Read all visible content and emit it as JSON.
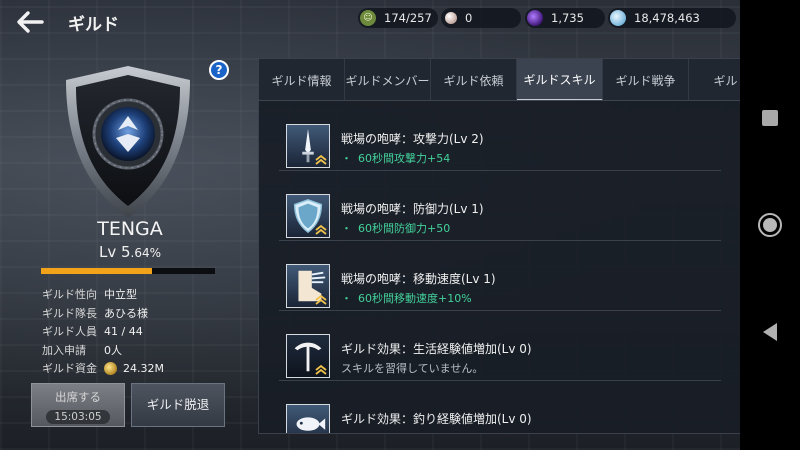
{
  "header": {
    "title": "ギルド",
    "currencies": {
      "stamina": "174/257",
      "pearl": "0",
      "gem": "1,735",
      "silver": "18,478,463"
    }
  },
  "guild": {
    "name": "TENGA",
    "level_text": "Lv 5",
    "level_percent_text": ".64%",
    "exp_fraction": 0.64,
    "info": [
      {
        "label": "ギルド性向",
        "value": "中立型"
      },
      {
        "label": "ギルド隊長",
        "value": "あひる様"
      },
      {
        "label": "ギルド人員",
        "value": "41 / 44"
      },
      {
        "label": "加入申請",
        "value": "0人"
      },
      {
        "label": "ギルド資金",
        "value": "24.32M"
      }
    ],
    "attend_label": "出席する",
    "attend_timer": "15:03:05",
    "leave_label": "ギルド脱退"
  },
  "tabs": [
    {
      "label": "ギルド情報"
    },
    {
      "label": "ギルドメンバー"
    },
    {
      "label": "ギルド依頼"
    },
    {
      "label": "ギルドスキル"
    },
    {
      "label": "ギルド戦争"
    },
    {
      "label": "ギルド"
    }
  ],
  "active_tab": "ギルドスキル",
  "skills": [
    {
      "name": "戦場の咆哮：攻撃力(Lv 2)",
      "desc": "60秒間攻撃力+54",
      "icon": "sword-icon"
    },
    {
      "name": "戦場の咆哮：防御力(Lv 1)",
      "desc": "60秒間防御力+50",
      "icon": "shield-icon"
    },
    {
      "name": "戦場の咆哮：移動速度(Lv 1)",
      "desc": "60秒間移動速度+10%",
      "icon": "boot-icon"
    },
    {
      "name": "ギルド効果：生活経験値増加(Lv 0)",
      "desc": "スキルを習得していません。",
      "icon": "pickaxe-icon"
    },
    {
      "name": "ギルド効果：釣り経験値増加(Lv 0)",
      "desc": "",
      "icon": "fish-icon"
    }
  ],
  "colors": {
    "accent_exp": "#f2a31a",
    "skill_effect_text": "#43d19a"
  }
}
